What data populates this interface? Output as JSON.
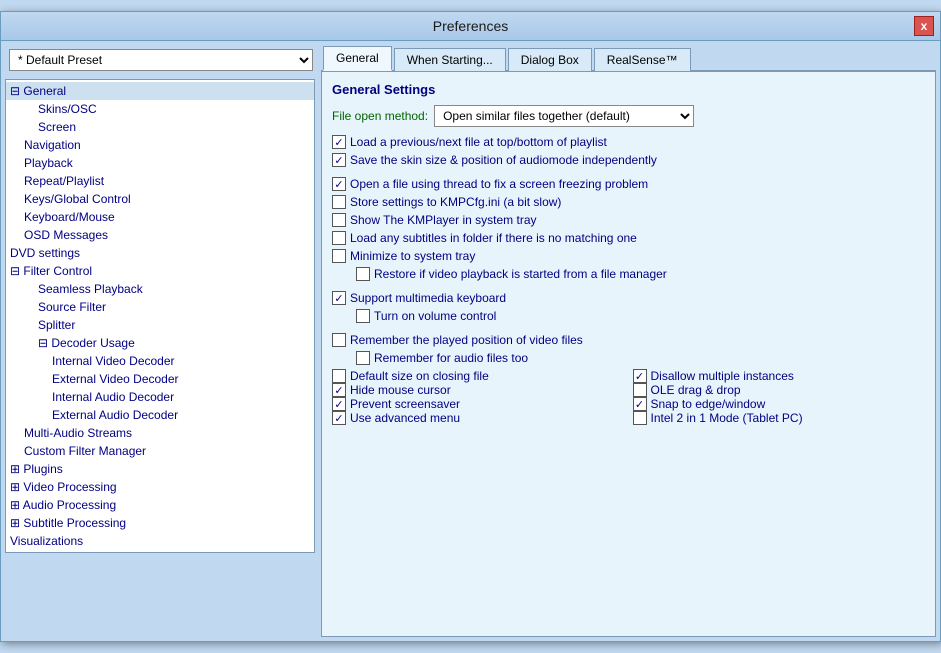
{
  "window": {
    "title": "Preferences",
    "close_label": "x"
  },
  "preset": {
    "value": "* Default Preset",
    "options": [
      "* Default Preset"
    ]
  },
  "tree": {
    "items": [
      {
        "label": "⊟ General",
        "indent": 0,
        "selected": true
      },
      {
        "label": "Skins/OSC",
        "indent": 2
      },
      {
        "label": "Screen",
        "indent": 2
      },
      {
        "label": "Navigation",
        "indent": 1
      },
      {
        "label": "Playback",
        "indent": 1
      },
      {
        "label": "Repeat/Playlist",
        "indent": 1
      },
      {
        "label": "Keys/Global Control",
        "indent": 1
      },
      {
        "label": "Keyboard/Mouse",
        "indent": 1
      },
      {
        "label": "OSD Messages",
        "indent": 1
      },
      {
        "label": "DVD settings",
        "indent": 0
      },
      {
        "label": "⊟ Filter Control",
        "indent": 0
      },
      {
        "label": "Seamless Playback",
        "indent": 2
      },
      {
        "label": "Source Filter",
        "indent": 2
      },
      {
        "label": "Splitter",
        "indent": 2
      },
      {
        "label": "⊟ Decoder Usage",
        "indent": 2
      },
      {
        "label": "Internal Video Decoder",
        "indent": 3
      },
      {
        "label": "External Video Decoder",
        "indent": 3
      },
      {
        "label": "Internal Audio Decoder",
        "indent": 3
      },
      {
        "label": "External Audio Decoder",
        "indent": 3
      },
      {
        "label": "Multi-Audio Streams",
        "indent": 1
      },
      {
        "label": "Custom Filter Manager",
        "indent": 1
      },
      {
        "label": "⊞ Plugins",
        "indent": 0
      },
      {
        "label": "⊞ Video Processing",
        "indent": 0
      },
      {
        "label": "⊞ Audio Processing",
        "indent": 0
      },
      {
        "label": "⊞ Subtitle Processing",
        "indent": 0
      },
      {
        "label": "Visualizations",
        "indent": 0
      }
    ]
  },
  "tabs": {
    "items": [
      {
        "label": "General",
        "active": true
      },
      {
        "label": "When Starting..."
      },
      {
        "label": "Dialog Box"
      },
      {
        "label": "RealSense™"
      }
    ]
  },
  "general_settings": {
    "section_title": "General Settings",
    "file_open_label": "File open method:",
    "file_open_value": "Open similar files together (default)",
    "file_open_options": [
      "Open similar files together (default)"
    ],
    "settings": [
      {
        "label": "Load a previous/next file at top/bottom of playlist",
        "checked": true,
        "indented": false
      },
      {
        "label": "Save the skin size & position of audiomode independently",
        "checked": true,
        "indented": false
      },
      {
        "spacer": true
      },
      {
        "label": "Open a file using thread to fix a screen freezing problem",
        "checked": true,
        "indented": false
      },
      {
        "label": "Store settings to KMPCfg.ini (a bit slow)",
        "checked": false,
        "indented": false
      },
      {
        "label": "Show The KMPlayer in system tray",
        "checked": false,
        "indented": false
      },
      {
        "label": "Load any subtitles in folder if there is no matching one",
        "checked": false,
        "indented": false
      },
      {
        "label": "Minimize to system tray",
        "checked": false,
        "indented": false
      },
      {
        "label": "Restore if video playback is started from a file manager",
        "checked": false,
        "indented": true
      },
      {
        "spacer": true
      },
      {
        "label": "Support multimedia keyboard",
        "checked": true,
        "indented": false
      },
      {
        "label": "Turn on volume control",
        "checked": false,
        "indented": true
      },
      {
        "spacer": true
      },
      {
        "label": "Remember the played position of video files",
        "checked": false,
        "indented": false
      },
      {
        "label": "Remember for audio files too",
        "checked": false,
        "indented": true
      }
    ],
    "bottom_left": [
      {
        "label": "Default size on closing file",
        "checked": false
      },
      {
        "label": "Hide mouse cursor",
        "checked": true
      },
      {
        "label": "Prevent screensaver",
        "checked": true
      },
      {
        "label": "Use advanced menu",
        "checked": true
      }
    ],
    "bottom_right": [
      {
        "label": "Disallow multiple instances",
        "checked": true
      },
      {
        "label": "OLE drag & drop",
        "checked": false
      },
      {
        "label": "Snap to edge/window",
        "checked": true
      },
      {
        "label": "Intel 2 in 1 Mode (Tablet PC)",
        "checked": false
      }
    ]
  }
}
